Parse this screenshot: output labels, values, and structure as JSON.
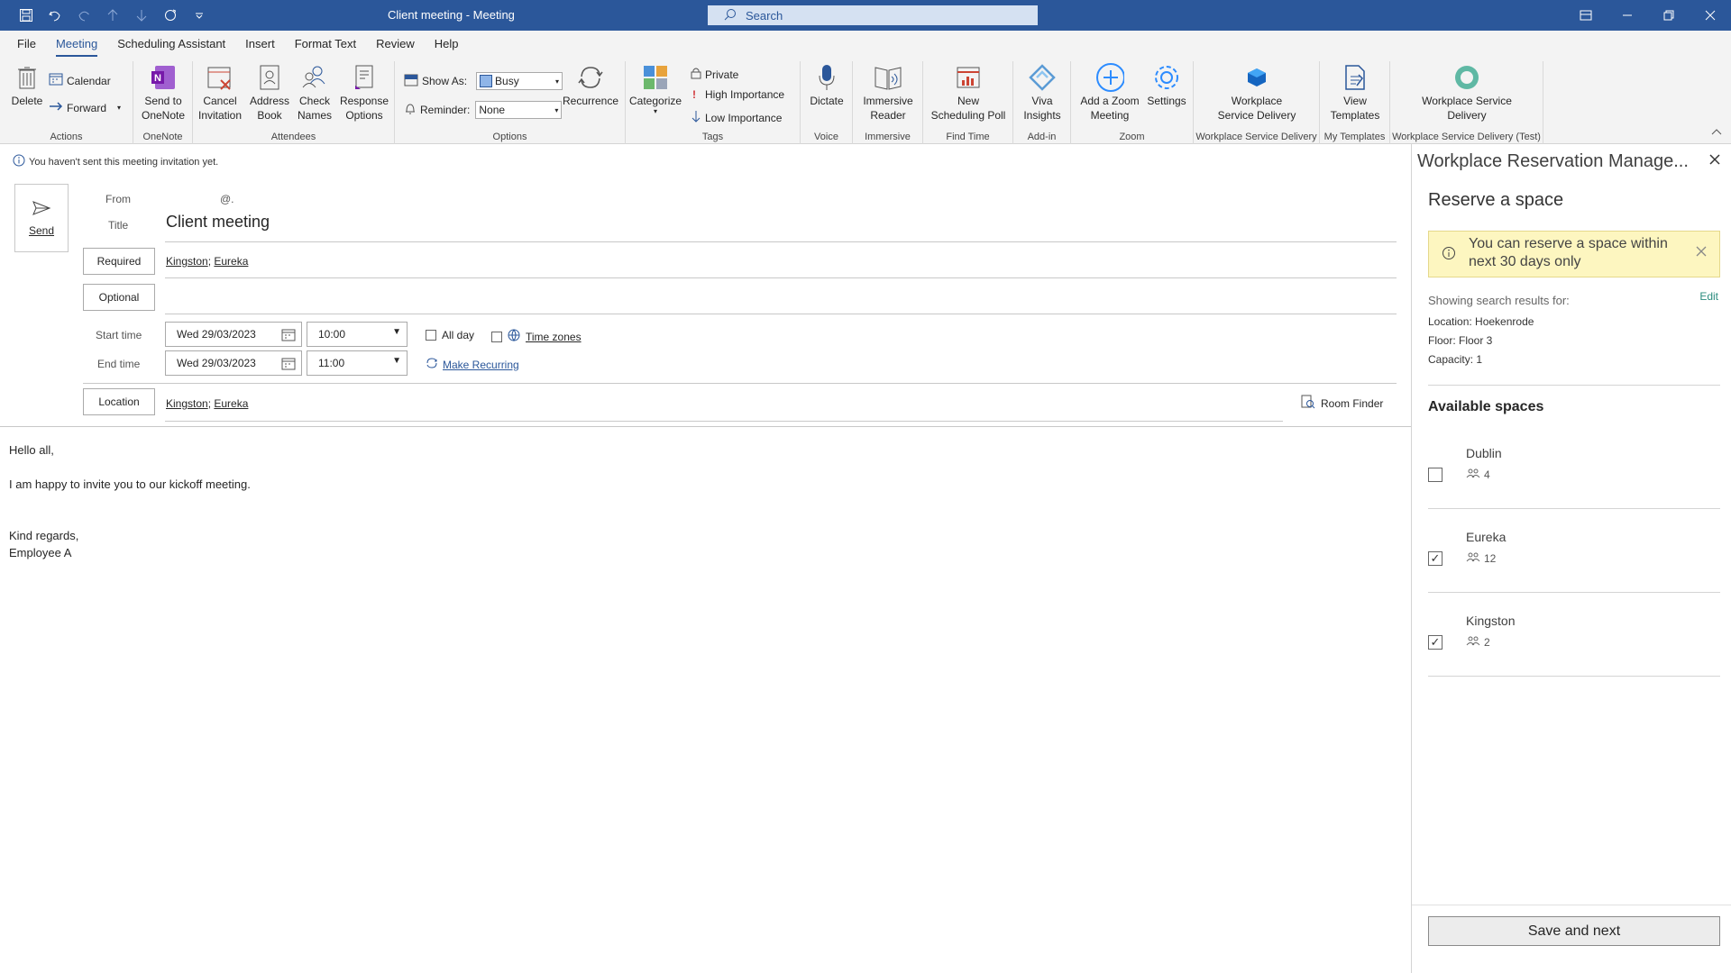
{
  "window": {
    "title": "Client meeting  -  Meeting",
    "search_placeholder": "Search"
  },
  "menu": {
    "tabs": [
      "File",
      "Meeting",
      "Scheduling Assistant",
      "Insert",
      "Format Text",
      "Review",
      "Help"
    ],
    "active": "Meeting"
  },
  "ribbon": {
    "actions": {
      "delete": "Delete",
      "calendar": "Calendar",
      "forward": "Forward",
      "label": "Actions"
    },
    "onenote": {
      "send": "Send to\nOneNote",
      "label": "OneNote"
    },
    "attendees": {
      "cancel": "Cancel\nInvitation",
      "address": "Address\nBook",
      "check": "Check\nNames",
      "response": "Response\nOptions",
      "label": "Attendees"
    },
    "options": {
      "show_as_label": "Show As:",
      "show_as_value": "Busy",
      "reminder_label": "Reminder:",
      "reminder_value": "None",
      "recurrence": "Recurrence",
      "label": "Options"
    },
    "tags": {
      "categorize": "Categorize",
      "private": "Private",
      "high": "High Importance",
      "low": "Low Importance",
      "label": "Tags"
    },
    "voice": {
      "dictate": "Dictate",
      "label": "Voice"
    },
    "immersive": {
      "reader": "Immersive\nReader",
      "label": "Immersive"
    },
    "findtime": {
      "poll": "New\nScheduling Poll",
      "label": "Find Time"
    },
    "addin": {
      "viva": "Viva\nInsights",
      "label": "Add-in"
    },
    "zoom": {
      "add": "Add a Zoom\nMeeting",
      "settings": "Settings",
      "label": "Zoom"
    },
    "wsd": {
      "btn": "Workplace\nService Delivery",
      "label": "Workplace Service Delivery"
    },
    "templates": {
      "view": "View\nTemplates",
      "label": "My Templates"
    },
    "wsd_test": {
      "btn": "Workplace Service\nDelivery",
      "label": "Workplace Service Delivery (Test)"
    }
  },
  "info_bar": "You haven't sent this meeting invitation yet.",
  "form": {
    "send": "Send",
    "from_label": "From",
    "from_value": "@.",
    "title_label": "Title",
    "title_value": "Client meeting",
    "required_label": "Required",
    "required_value": [
      "Kingston",
      "Eureka"
    ],
    "optional_label": "Optional",
    "start_label": "Start time",
    "start_date": "Wed 29/03/2023",
    "start_time": "10:00",
    "end_label": "End time",
    "end_date": "Wed 29/03/2023",
    "end_time": "11:00",
    "all_day": "All day",
    "time_zones": "Time zones",
    "make_recurring": "Make Recurring",
    "location_label": "Location",
    "location_value": [
      "Kingston",
      "Eureka"
    ],
    "room_finder": "Room Finder"
  },
  "body": {
    "line1": "Hello all,",
    "line2": "I am happy to invite you to our kickoff meeting.",
    "line3": "Kind regards,",
    "line4": "Employee A"
  },
  "pane": {
    "title": "Workplace Reservation Manage...",
    "heading": "Reserve a space",
    "warning": "You can reserve a space within next 30 days only",
    "showing": "Showing search results for:",
    "edit": "Edit",
    "location": "Location: Hoekenrode",
    "floor": "Floor: Floor 3",
    "capacity": "Capacity: 1",
    "available": "Available spaces",
    "spaces": [
      {
        "name": "Dublin",
        "capacity": "4",
        "checked": false
      },
      {
        "name": "Eureka",
        "capacity": "12",
        "checked": true
      },
      {
        "name": "Kingston",
        "capacity": "2",
        "checked": true
      }
    ],
    "save": "Save and next"
  }
}
